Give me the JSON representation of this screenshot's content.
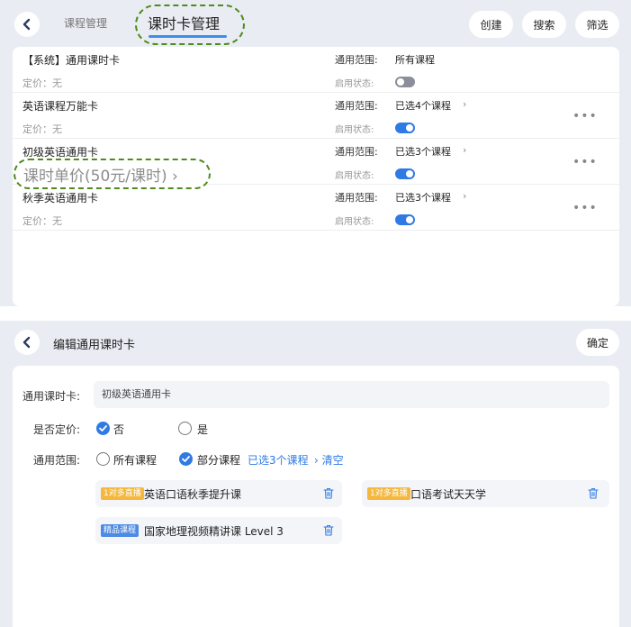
{
  "list_view": {
    "tabs": [
      {
        "label": "课程管理"
      },
      {
        "label": "课时卡管理"
      }
    ],
    "actions": {
      "create": "创建",
      "search": "搜索",
      "filter": "筛选"
    },
    "cards": [
      {
        "name": "【系统】通用课时卡",
        "price": "定价：无",
        "scope_label": "通用范围:",
        "scope_value": "所有课程",
        "status_label": "启用状态:",
        "enabled": false,
        "has_more": false,
        "has_chevron": false
      },
      {
        "name": "英语课程万能卡",
        "price": "定价：无",
        "scope_label": "通用范围:",
        "scope_value": "已选4个课程",
        "status_label": "启用状态:",
        "enabled": true,
        "has_more": true,
        "has_chevron": true
      },
      {
        "name": "初级英语通用卡",
        "price": "",
        "scope_label": "通用范围:",
        "scope_value": "已选3个课程",
        "status_label": "启用状态:",
        "enabled": true,
        "has_more": true,
        "has_chevron": true
      },
      {
        "name": "秋季英语通用卡",
        "price": "定价：无",
        "scope_label": "通用范围:",
        "scope_value": "已选3个课程",
        "status_label": "启用状态:",
        "enabled": true,
        "has_more": true,
        "has_chevron": true
      }
    ],
    "more_glyph": "•••",
    "chevron_glyph": "›",
    "callout": "课时单价(50元/课时)  ›"
  },
  "edit_view": {
    "title": "编辑通用课时卡",
    "confirm": "确定",
    "card_field": {
      "label": "通用课时卡:",
      "value": "初级英语通用卡"
    },
    "pricing": {
      "label": "是否定价:",
      "options": [
        {
          "label": "否",
          "checked": true
        },
        {
          "label": "是",
          "checked": false
        }
      ]
    },
    "scope": {
      "label": "通用范围:",
      "options": [
        {
          "label": "所有课程",
          "checked": false
        },
        {
          "label": "部分课程",
          "checked": true
        }
      ],
      "selected_text": "已选3个课程",
      "clear_text": "› 清空"
    },
    "courses": [
      {
        "badge": "1对多直播",
        "badge_type": "live",
        "name": "英语口语秋季提升课"
      },
      {
        "badge": "1对多直播",
        "badge_type": "live",
        "name": "口语考试天天学"
      },
      {
        "badge": "精品课程",
        "badge_type": "premium",
        "name": "国家地理视频精讲课 Level 3"
      }
    ]
  },
  "colors": {
    "accent": "#2f7ae5",
    "callout_border": "#4f8a1c",
    "panel_bg": "#e9edf3",
    "badge_live": "#f5b83d",
    "badge_premium": "#4d8ae3"
  },
  "icons": {
    "back": "chevron-left-icon",
    "trash": "trash-icon",
    "check": "check-icon"
  }
}
